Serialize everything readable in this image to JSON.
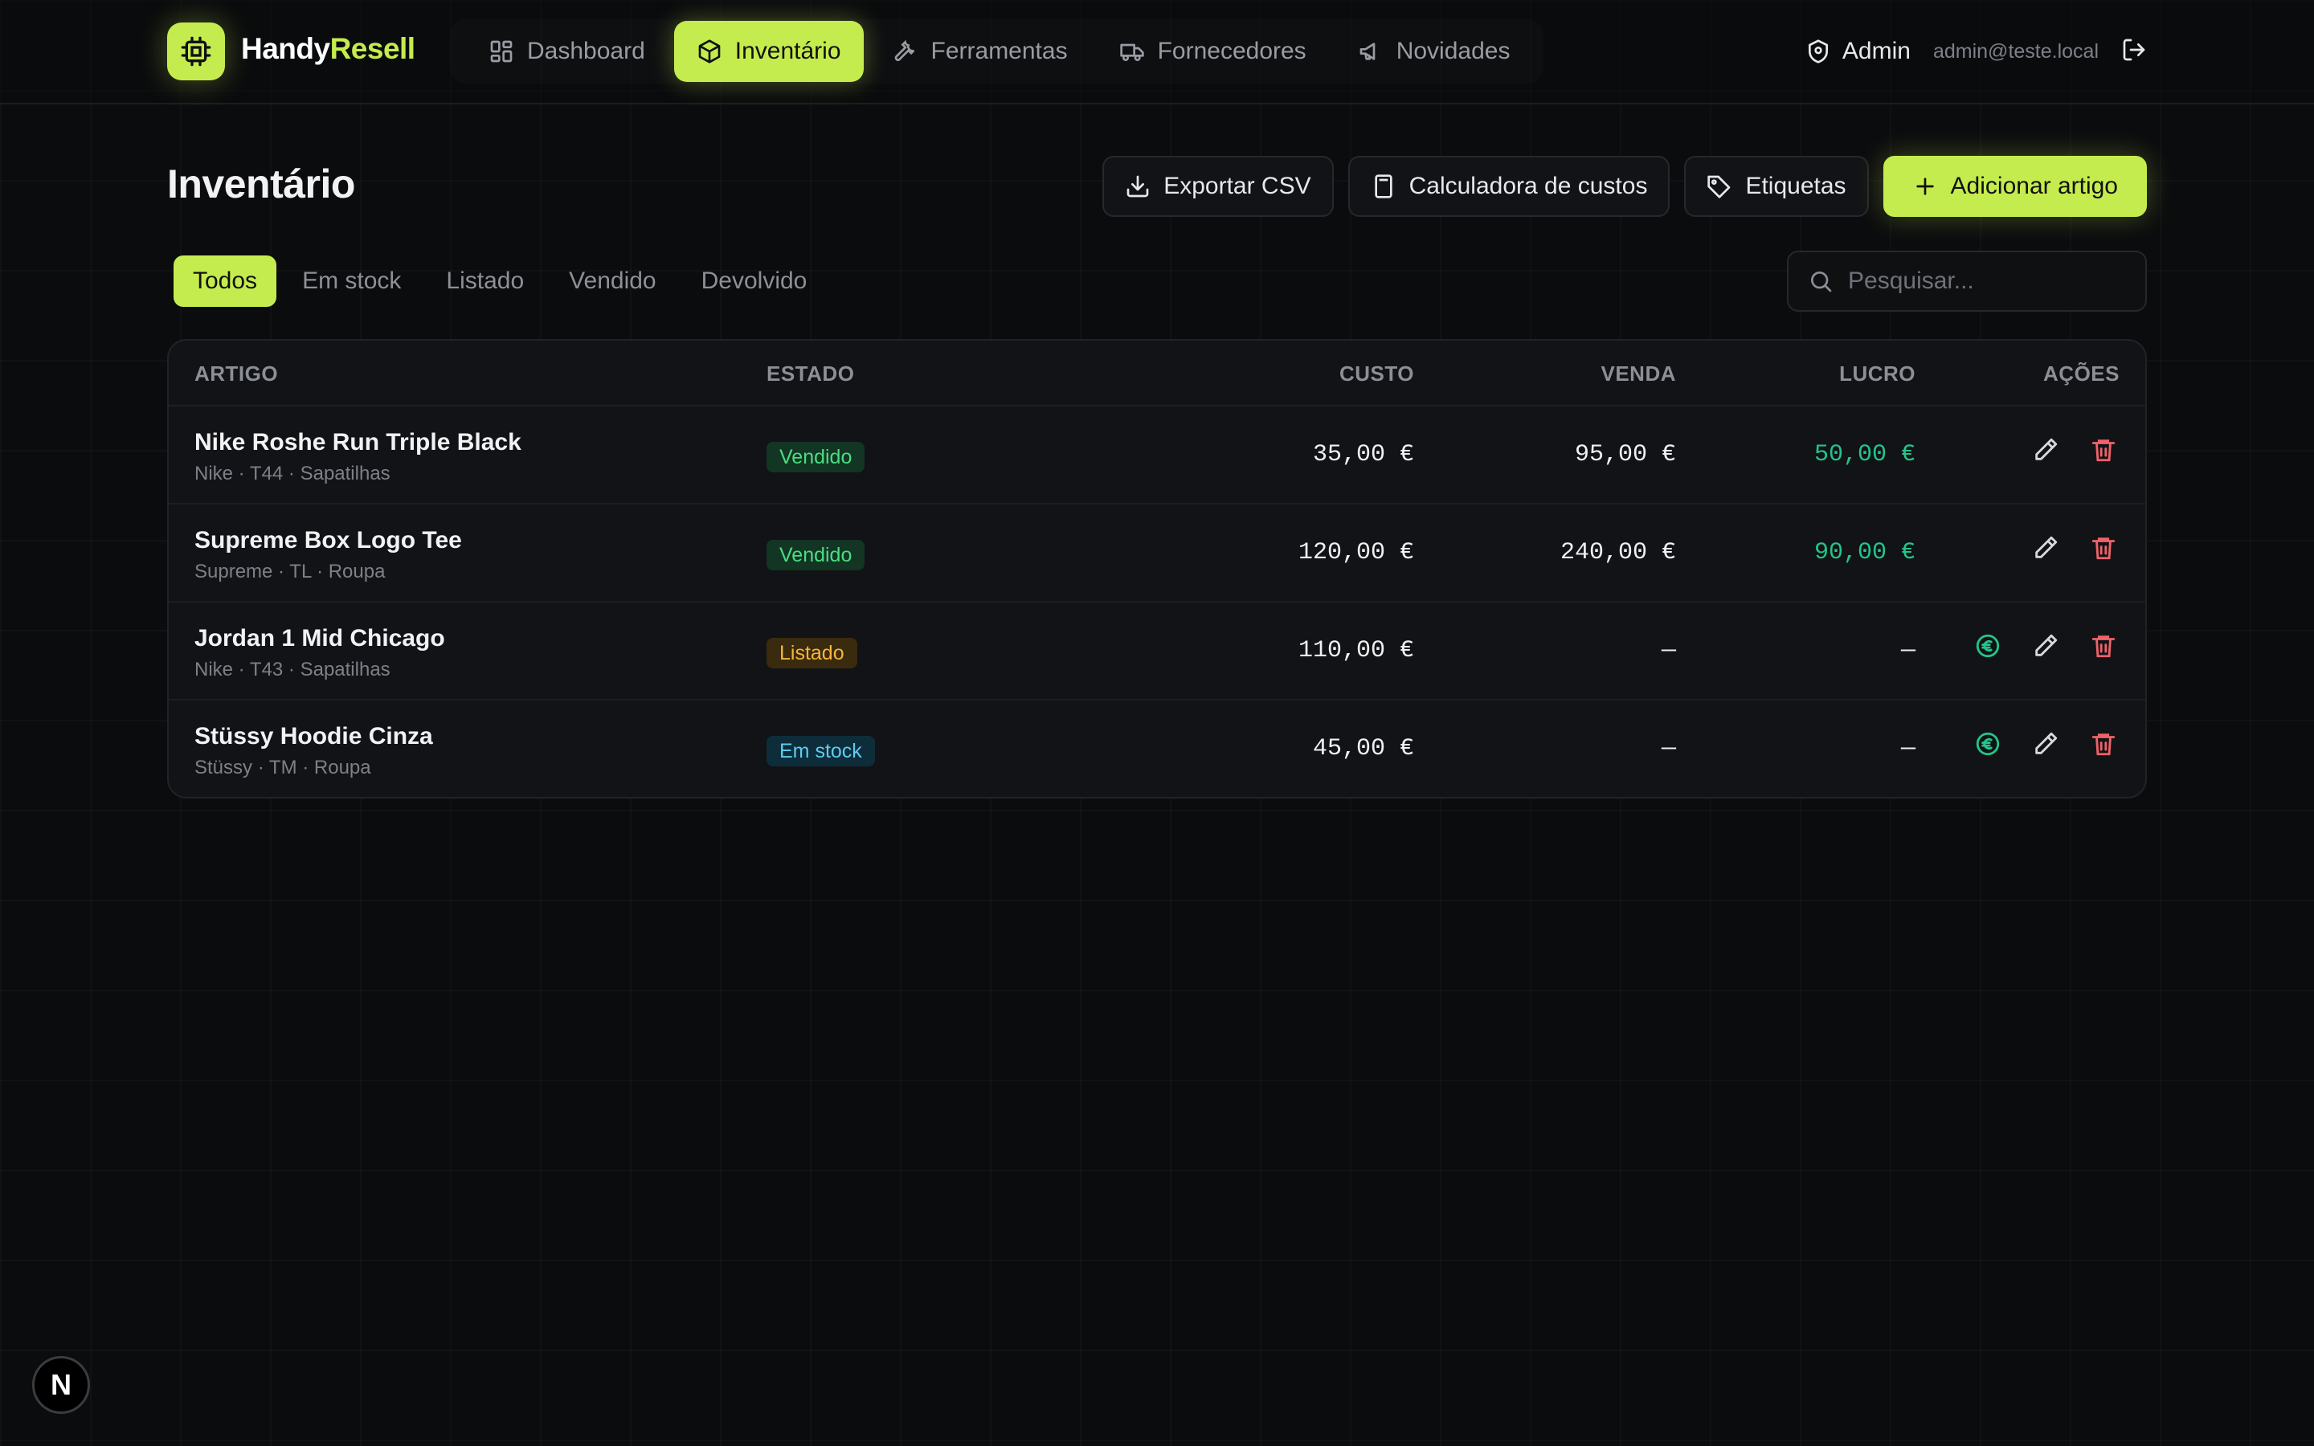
{
  "brand": {
    "name_part1": "Handy",
    "name_part2": "Resell"
  },
  "nav": {
    "items": [
      {
        "label": "Dashboard",
        "icon": "grid-icon"
      },
      {
        "label": "Inventário",
        "icon": "box-icon",
        "active": true
      },
      {
        "label": "Ferramentas",
        "icon": "wrench-icon"
      },
      {
        "label": "Fornecedores",
        "icon": "truck-icon"
      },
      {
        "label": "Novidades",
        "icon": "megaphone-icon"
      }
    ]
  },
  "user": {
    "role": "Admin",
    "email": "admin@teste.local"
  },
  "page": {
    "title": "Inventário"
  },
  "actions": {
    "export": "Exportar CSV",
    "calculator": "Calculadora de custos",
    "labels": "Etiquetas",
    "add": "Adicionar artigo"
  },
  "tabs": [
    "Todos",
    "Em stock",
    "Listado",
    "Vendido",
    "Devolvido"
  ],
  "search": {
    "placeholder": "Pesquisar..."
  },
  "table": {
    "headers": {
      "artigo": "ARTIGO",
      "estado": "ESTADO",
      "custo": "CUSTO",
      "venda": "VENDA",
      "lucro": "LUCRO",
      "acoes": "AÇÕES"
    },
    "rows": [
      {
        "name": "Nike Roshe Run Triple Black",
        "meta": "Nike · T44 · Sapatilhas",
        "status": "Vendido",
        "cost": "35,00 €",
        "sale": "95,00 €",
        "profit": "50,00 €"
      },
      {
        "name": "Supreme Box Logo Tee",
        "meta": "Supreme · TL · Roupa",
        "status": "Vendido",
        "cost": "120,00 €",
        "sale": "240,00 €",
        "profit": "90,00 €"
      },
      {
        "name": "Jordan 1 Mid Chicago",
        "meta": "Nike · T43 · Sapatilhas",
        "status": "Listado",
        "cost": "110,00 €",
        "sale": "—",
        "profit": "—"
      },
      {
        "name": "Stüssy Hoodie Cinza",
        "meta": "Stüssy · TM · Roupa",
        "status": "Em stock",
        "cost": "45,00 €",
        "sale": "—",
        "profit": "—"
      }
    ]
  },
  "dev_badge": "N",
  "colors": {
    "accent": "#c5ec4e",
    "profit": "#22c58a",
    "danger": "#f0626a",
    "background": "#0b0c0e"
  }
}
